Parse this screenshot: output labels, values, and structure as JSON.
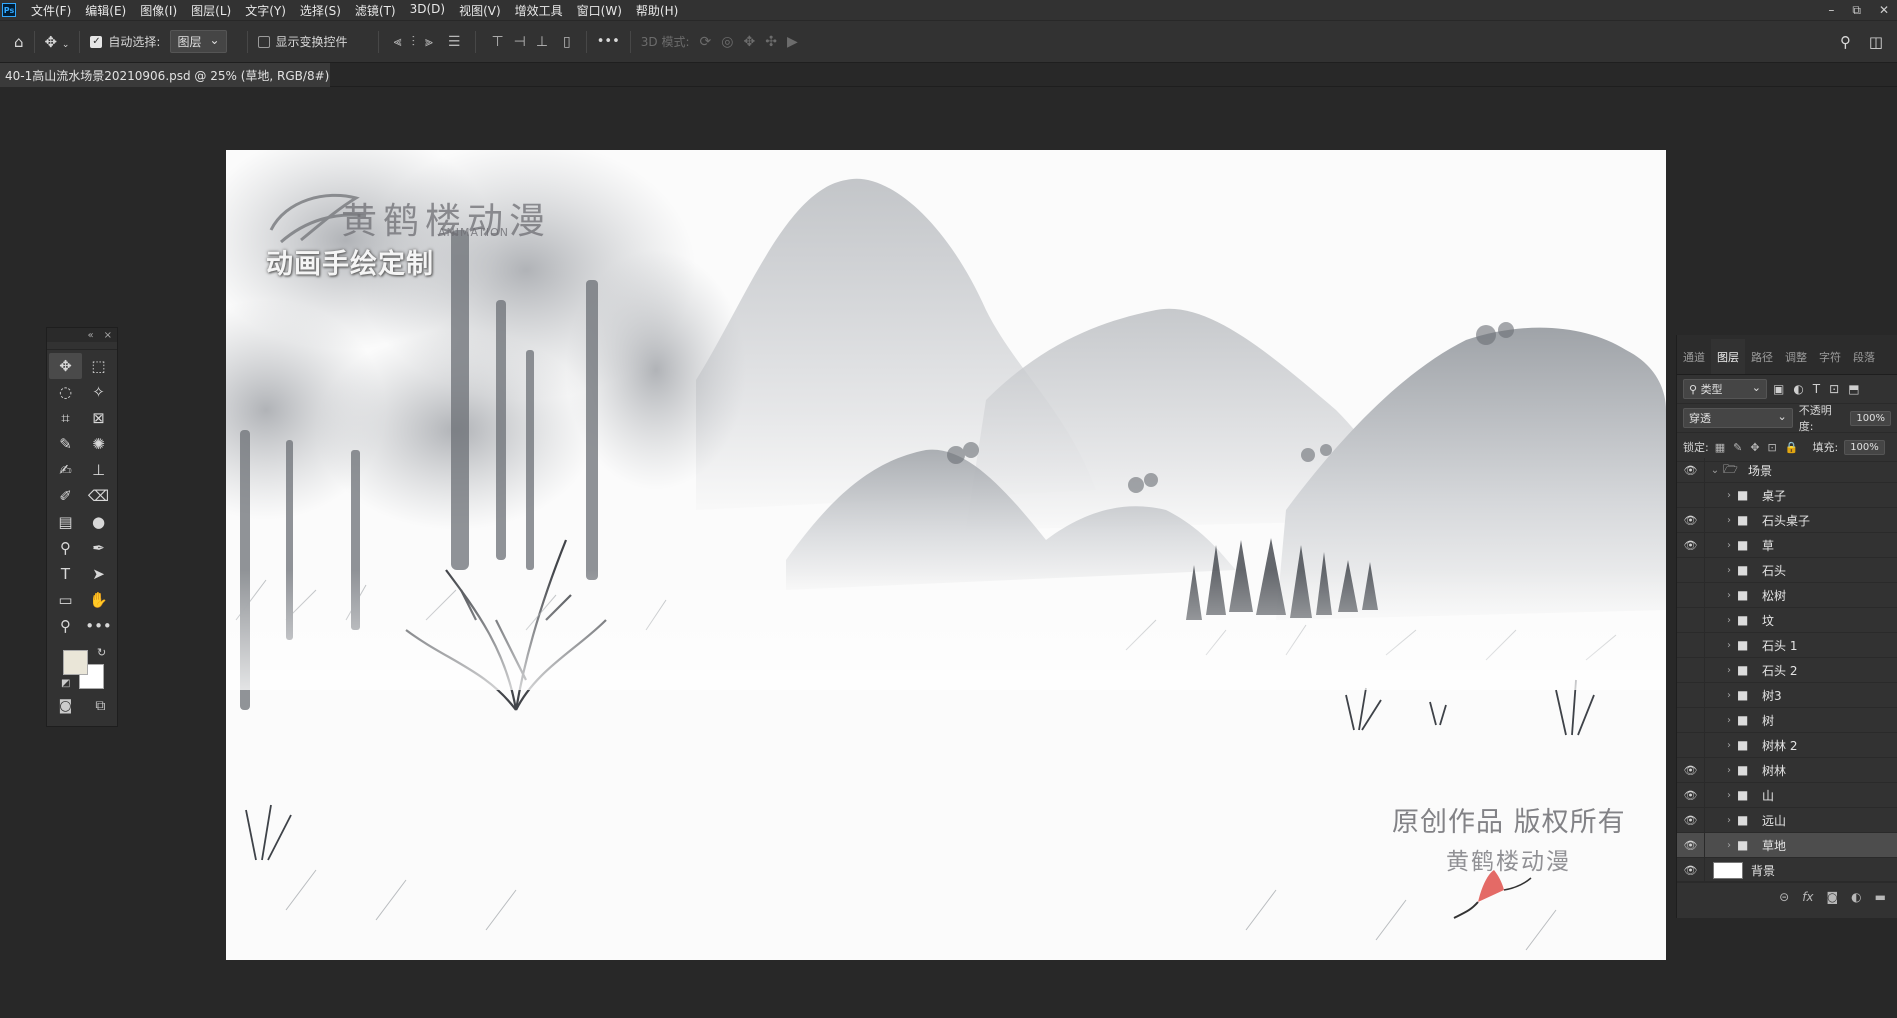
{
  "app": {
    "logo": "Ps"
  },
  "menu": [
    "文件(F)",
    "编辑(E)",
    "图像(I)",
    "图层(L)",
    "文字(Y)",
    "选择(S)",
    "滤镜(T)",
    "3D(D)",
    "视图(V)",
    "增效工具",
    "窗口(W)",
    "帮助(H)"
  ],
  "window_controls": {
    "minimize": "–",
    "restore": "⧉",
    "close": "✕"
  },
  "options": {
    "auto_select_label": "自动选择:",
    "auto_select_checked": true,
    "auto_select_value": "图层",
    "show_transform_label": "显示变换控件",
    "mode_3d_label": "3D 模式:",
    "more": "•••"
  },
  "document_tab": {
    "title": "40-1高山流水场景20210906.psd @ 25% (草地, RGB/8#) *",
    "close": "×"
  },
  "canvas": {
    "brand": "黄鹤楼动漫",
    "brand_sub": "ANIMATION",
    "tagline": "动画手绘定制",
    "copyright_line1": "原创作品 版权所有",
    "copyright_line2": "黄鹤楼动漫"
  },
  "toolbox": {
    "collapse": "«",
    "close": "×",
    "tools": [
      {
        "name": "move-tool",
        "glyph": "✥"
      },
      {
        "name": "marquee-tool",
        "glyph": "⬚"
      },
      {
        "name": "lasso-tool",
        "glyph": "◌"
      },
      {
        "name": "magic-wand-tool",
        "glyph": "✧"
      },
      {
        "name": "crop-tool",
        "glyph": "⌗"
      },
      {
        "name": "frame-tool",
        "glyph": "⊠"
      },
      {
        "name": "eyedropper-tool",
        "glyph": "✎"
      },
      {
        "name": "healing-tool",
        "glyph": "✺"
      },
      {
        "name": "brush-tool",
        "glyph": "✍"
      },
      {
        "name": "stamp-tool",
        "glyph": "⊥"
      },
      {
        "name": "history-brush-tool",
        "glyph": "✐"
      },
      {
        "name": "eraser-tool",
        "glyph": "⌫"
      },
      {
        "name": "gradient-tool",
        "glyph": "▤"
      },
      {
        "name": "blur-tool",
        "glyph": "●"
      },
      {
        "name": "dodge-tool",
        "glyph": "⚲"
      },
      {
        "name": "pen-tool",
        "glyph": "✒"
      },
      {
        "name": "type-tool",
        "glyph": "T"
      },
      {
        "name": "path-select-tool",
        "glyph": "➤"
      },
      {
        "name": "rectangle-tool",
        "glyph": "▭"
      },
      {
        "name": "hand-tool",
        "glyph": "✋"
      },
      {
        "name": "zoom-tool",
        "glyph": "⚲"
      },
      {
        "name": "more-tools",
        "glyph": "•••"
      }
    ],
    "foreground_color": "#eae6d8",
    "background_color": "#ffffff"
  },
  "panel": {
    "tabs": [
      "通道",
      "图层",
      "路径",
      "调整",
      "字符",
      "段落"
    ],
    "active_tab": "图层",
    "filter_label": "类型",
    "blend_mode": "穿透",
    "opacity_label": "不透明度:",
    "opacity_value": "100%",
    "lock_label": "锁定:",
    "fill_label": "填充:",
    "fill_value": "100%",
    "layers": [
      {
        "name": "场景",
        "visible": true,
        "type": "group-open",
        "indent": 0
      },
      {
        "name": "桌子",
        "visible": false,
        "type": "group",
        "indent": 1
      },
      {
        "name": "石头桌子",
        "visible": true,
        "type": "group",
        "indent": 1
      },
      {
        "name": "草",
        "visible": true,
        "type": "group",
        "indent": 1
      },
      {
        "name": "石头",
        "visible": false,
        "type": "group",
        "indent": 1
      },
      {
        "name": "松树",
        "visible": false,
        "type": "group",
        "indent": 1
      },
      {
        "name": "坟",
        "visible": false,
        "type": "group",
        "indent": 1
      },
      {
        "name": "石头 1",
        "visible": false,
        "type": "group",
        "indent": 1
      },
      {
        "name": "石头 2",
        "visible": false,
        "type": "group",
        "indent": 1
      },
      {
        "name": "树3",
        "visible": false,
        "type": "group",
        "indent": 1
      },
      {
        "name": "树",
        "visible": false,
        "type": "group",
        "indent": 1
      },
      {
        "name": "树林 2",
        "visible": false,
        "type": "group",
        "indent": 1
      },
      {
        "name": "树林",
        "visible": true,
        "type": "group",
        "indent": 1
      },
      {
        "name": "山",
        "visible": true,
        "type": "group",
        "indent": 1
      },
      {
        "name": "远山",
        "visible": true,
        "type": "group",
        "indent": 1
      },
      {
        "name": "草地",
        "visible": true,
        "type": "group",
        "indent": 1,
        "selected": true
      },
      {
        "name": "背景",
        "visible": true,
        "type": "pixel",
        "indent": 0
      }
    ]
  }
}
